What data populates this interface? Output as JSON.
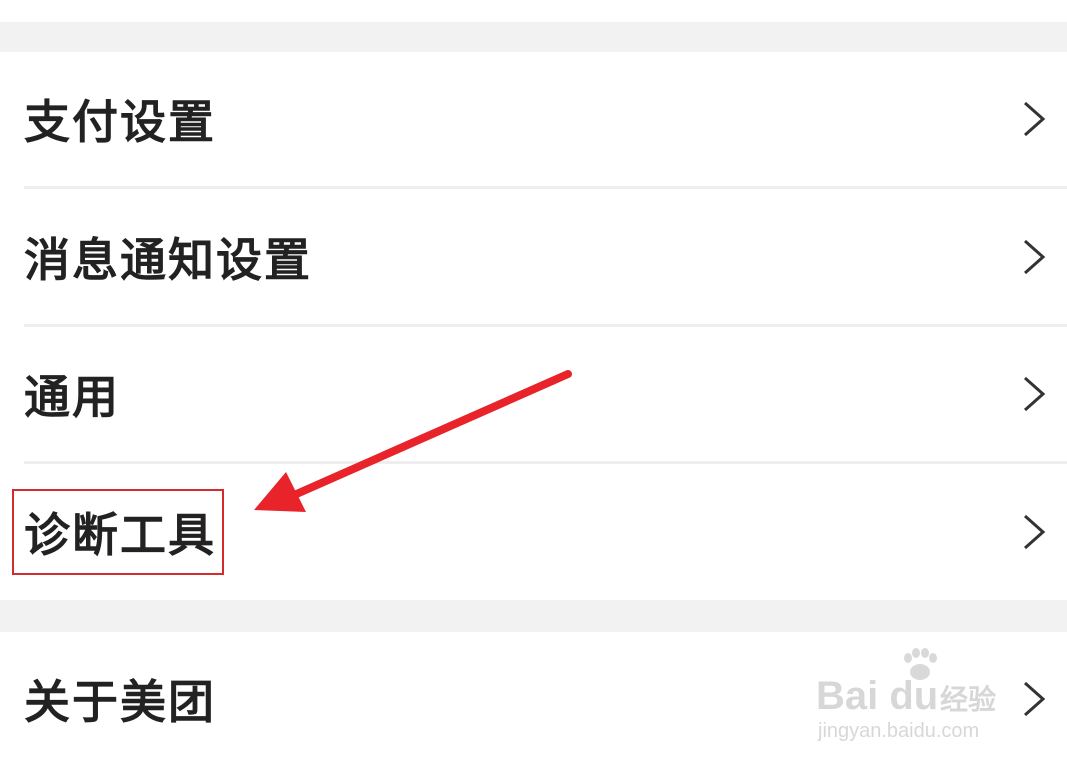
{
  "settings": {
    "group1": {
      "items": [
        {
          "label": "支付设置"
        },
        {
          "label": "消息通知设置"
        },
        {
          "label": "通用"
        },
        {
          "label": "诊断工具"
        }
      ]
    },
    "group2": {
      "items": [
        {
          "label": "关于美团"
        }
      ]
    }
  },
  "annotation": {
    "arrow_color": "#e8232a",
    "highlight_color": "#d42c2c",
    "highlighted_item": "诊断工具"
  },
  "watermark": {
    "brand": "Bai du",
    "jingyan": "经验",
    "url": "jingyan.baidu.com"
  },
  "icons": {
    "row_chevron": "chevron-right-icon",
    "watermark_paw": "paw-icon"
  }
}
